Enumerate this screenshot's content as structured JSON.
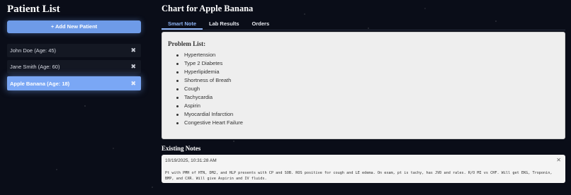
{
  "sidebar": {
    "title": "Patient List",
    "add_button": "+ Add New Patient",
    "close_glyph": "✖",
    "patients": [
      {
        "label": "John Doe (Age: 45)"
      },
      {
        "label": "Jane Smith (Age: 60)"
      },
      {
        "label": "Apple Banana (Age: 18)"
      }
    ]
  },
  "main": {
    "title": "Chart for Apple Banana",
    "tabs": [
      {
        "label": "Smart Note"
      },
      {
        "label": "Lab Results"
      },
      {
        "label": "Orders"
      }
    ],
    "problem_list": {
      "title": "Problem List:",
      "items": [
        "Hypertension",
        "Type 2 Diabetes",
        "Hyperlipidemia",
        "Shortness of Breath",
        "Cough",
        "Tachycardia",
        "Aspirin",
        "Myocardial Infarction",
        "Congestive Heart Failure"
      ]
    },
    "existing_notes": {
      "title": "Existing Notes",
      "notes": [
        {
          "timestamp": "10/19/2025, 10:31:28 AM",
          "text": "Pt with PMH of HTN, DM2, and HLP presents with CP and SOB. ROS positive for cough and LE edema. On exam, pt is tachy, has JVD and rales. R/O MI vs CHF. Will get EKG, Troponin, BMP, and CXR. Will give Aspirin and IV fluids.",
          "close_glyph": "✕"
        }
      ]
    }
  },
  "colors": {
    "background": "#0a0d18",
    "accent": "#6e9be8",
    "active_patient": "#7aa7f5",
    "active_tab": "#8fb4f5"
  }
}
